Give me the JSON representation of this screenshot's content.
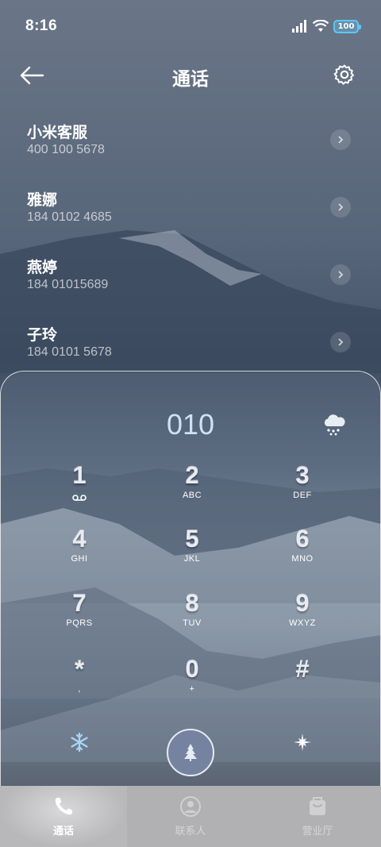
{
  "status_bar": {
    "time": "8:16",
    "battery": "100",
    "icons": [
      "signal-icon",
      "wifi-icon",
      "battery-icon"
    ]
  },
  "header": {
    "title": "通话",
    "back_icon": "back-arrow-icon",
    "settings_icon": "gear-icon"
  },
  "contacts": [
    {
      "name": "小米客服",
      "number": "400 100 5678"
    },
    {
      "name": "雅娜",
      "number": "184 0102 4685"
    },
    {
      "name": "燕婷",
      "number": "184 01015689"
    },
    {
      "name": "子玲",
      "number": "184 0101 5678"
    }
  ],
  "dialpad": {
    "input": "010",
    "weather_icon": "snow-cloud-icon",
    "keys": [
      {
        "digit": "1",
        "letters": "",
        "sub_icon": "voicemail-icon"
      },
      {
        "digit": "2",
        "letters": "ABC"
      },
      {
        "digit": "3",
        "letters": "DEF"
      },
      {
        "digit": "4",
        "letters": "GHI"
      },
      {
        "digit": "5",
        "letters": "JKL"
      },
      {
        "digit": "6",
        "letters": "MNO"
      },
      {
        "digit": "7",
        "letters": "PQRS"
      },
      {
        "digit": "8",
        "letters": "TUV"
      },
      {
        "digit": "9",
        "letters": "WXYZ"
      },
      {
        "digit": "*",
        "letters": ","
      },
      {
        "digit": "0",
        "letters": "+"
      },
      {
        "digit": "#",
        "letters": ""
      }
    ],
    "left_icon": "snowflake-icon",
    "call_icon": "tree-call-icon",
    "right_icon": "star-icon"
  },
  "tabbar": {
    "tabs": [
      {
        "label": "通话",
        "icon": "phone-icon",
        "active": true
      },
      {
        "label": "联系人",
        "icon": "person-icon",
        "active": false
      },
      {
        "label": "营业厅",
        "icon": "store-icon",
        "active": false
      }
    ]
  },
  "colors": {
    "accent_digits": "#cfe2f5",
    "battery": "#5ec7f0",
    "call_button": "#7583a0",
    "tabbar": "#b1b1b3"
  }
}
